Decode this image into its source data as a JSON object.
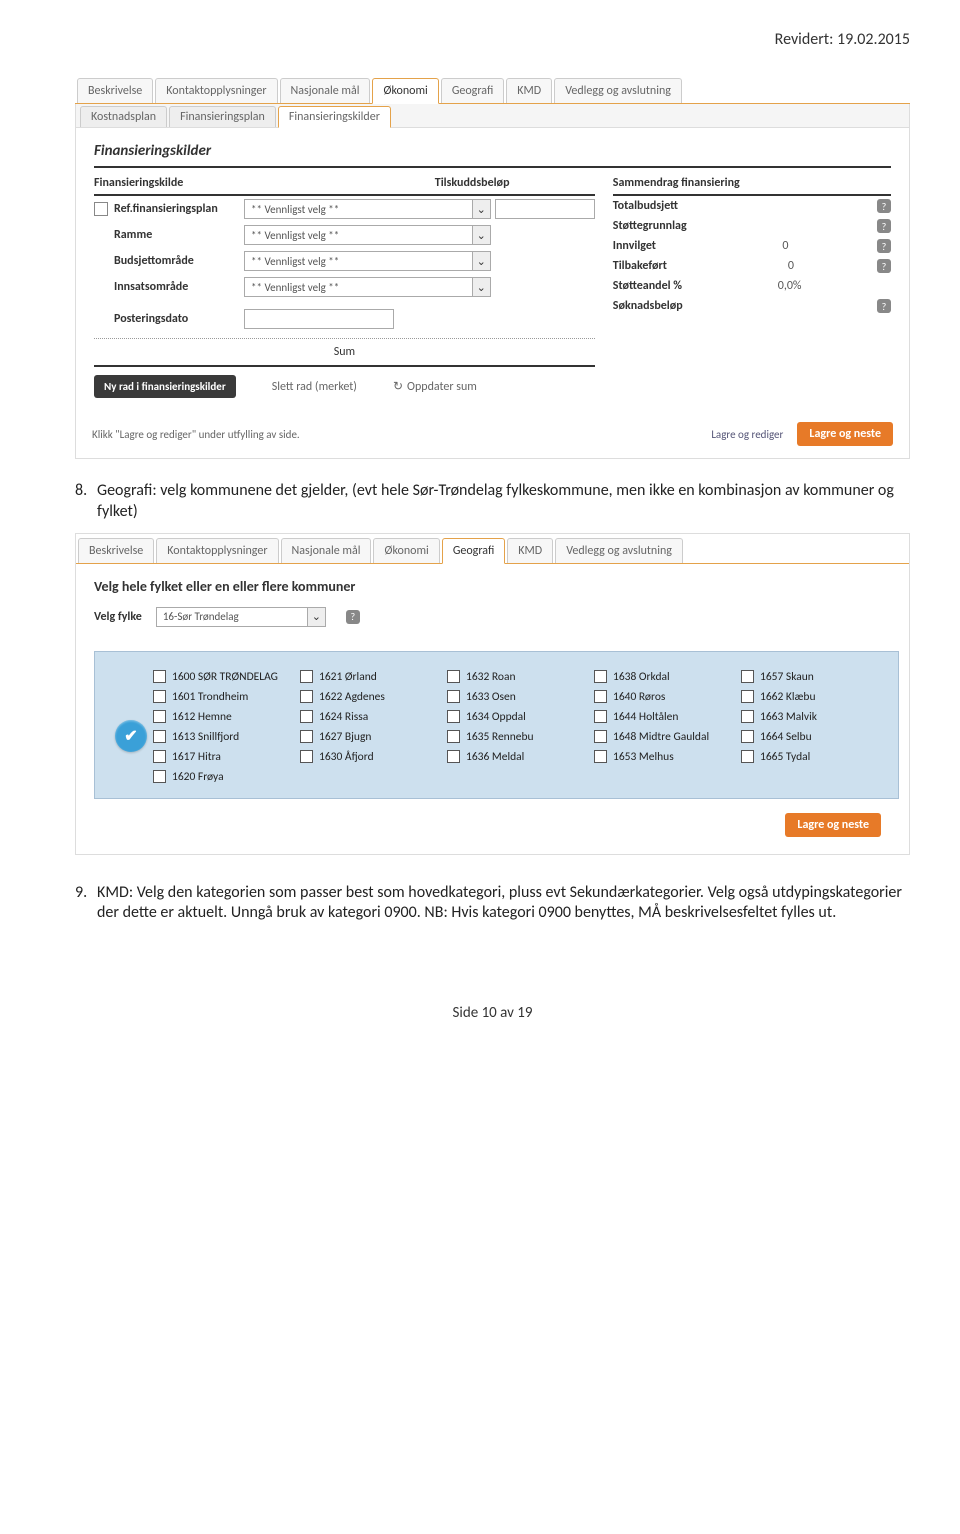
{
  "header_date": "Revidert: 19.02.2015",
  "tabs_main": [
    "Beskrivelse",
    "Kontaktopplysninger",
    "Nasjonale mål",
    "Økonomi",
    "Geografi",
    "KMD",
    "Vedlegg og avslutning"
  ],
  "tabs_main_active": 3,
  "subtabs": [
    "Kostnadsplan",
    "Finansieringsplan",
    "Finansieringskilder"
  ],
  "subtabs_active": 2,
  "fk_title": "Finansieringskilder",
  "fk_head_col1": "Finansieringskilde",
  "fk_head_col3": "Tilskuddsbeløp",
  "fk_sumhead": "Sammendrag finansiering",
  "fk_rows": {
    "ref": "Ref.finansieringsplan",
    "ramme": "Ramme",
    "budsj": "Budsjettområde",
    "innsats": "Innsatsområde",
    "post": "Posteringsdato"
  },
  "dd_placeholder": "** Vennligst velg **",
  "sumlabel": "Sum",
  "btn_ny": "Ny rad i finansieringskilder",
  "btn_slett": "Slett rad (merket)",
  "btn_oppdater": "Oppdater sum",
  "fin_summary": [
    {
      "l": "Totalbudsjett",
      "v": ""
    },
    {
      "l": "Støttegrunnlag",
      "v": ""
    },
    {
      "l": "Innvilget",
      "v": "0"
    },
    {
      "l": "Tilbakeført",
      "v": "0"
    },
    {
      "l": "Støtteandel %",
      "v": "0,0%"
    },
    {
      "l": "Søknadsbeløp",
      "v": ""
    }
  ],
  "footer_hint": "Klikk \"Lagre og rediger\" under utfylling av side.",
  "btn_lagre_rediger": "Lagre og rediger",
  "btn_lagre_neste": "Lagre og neste",
  "item8": "Geografi: velg kommunene det gjelder, (evt hele Sør-Trøndelag fylkeskommune, men ikke en kombinasjon av kommuner og fylket)",
  "tabs2_active": 4,
  "velg_heading": "Velg hele fylket eller en eller flere kommuner",
  "velg_fylke_lbl": "Velg fylke",
  "velg_fylke_val": "16-Sør Trøndelag",
  "kommuner": [
    "1600 SØR TRØNDELAG",
    "1621 Ørland",
    "1632 Roan",
    "1638 Orkdal",
    "1657 Skaun",
    "1601 Trondheim",
    "1622 Agdenes",
    "1633 Osen",
    "1640 Røros",
    "1662 Klæbu",
    "1612 Hemne",
    "1624 Rissa",
    "1634 Oppdal",
    "1644 Holtålen",
    "1663 Malvik",
    "1613 Snillfjord",
    "1627 Bjugn",
    "1635 Rennebu",
    "1648 Midtre Gauldal",
    "1664 Selbu",
    "1617 Hitra",
    "1630 Åfjord",
    "1636 Meldal",
    "1653 Melhus",
    "1665 Tydal",
    "1620 Frøya"
  ],
  "item9": "KMD: Velg den kategorien som passer best som hovedkategori, pluss evt Sekundærkategorier. Velg også utdypingskategorier der dette er aktuelt. Unngå bruk av kategori 0900. NB: Hvis kategori 0900 benyttes, MÅ beskrivelsesfeltet fylles ut.",
  "page_footer": "Side 10 av 19"
}
